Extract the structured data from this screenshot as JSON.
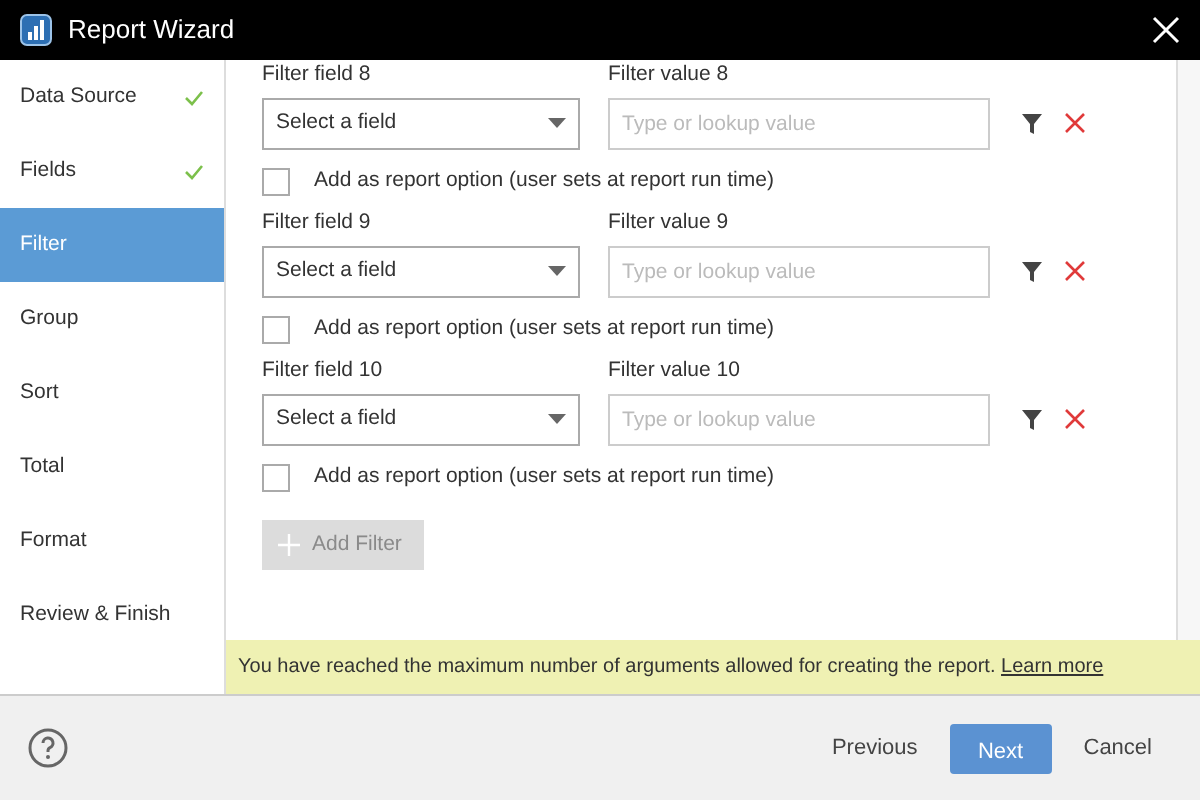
{
  "window": {
    "title": "Report Wizard"
  },
  "sidebar": {
    "items": [
      {
        "label": "Data Source",
        "done": true,
        "selected": false
      },
      {
        "label": "Fields",
        "done": true,
        "selected": false
      },
      {
        "label": "Filter",
        "done": false,
        "selected": true
      },
      {
        "label": "Group",
        "done": false,
        "selected": false
      },
      {
        "label": "Sort",
        "done": false,
        "selected": false
      },
      {
        "label": "Total",
        "done": false,
        "selected": false
      },
      {
        "label": "Format",
        "done": false,
        "selected": false
      },
      {
        "label": "Review & Finish",
        "done": false,
        "selected": false
      }
    ]
  },
  "filters": [
    {
      "field_label": "Filter field 8",
      "field_value": "Select a field",
      "value_label": "Filter value 8",
      "value_placeholder": "Type or lookup value",
      "option_label": "Add as report option (user sets at report run time)",
      "option_checked": false
    },
    {
      "field_label": "Filter field 9",
      "field_value": "Select a field",
      "value_label": "Filter value 9",
      "value_placeholder": "Type or lookup value",
      "option_label": "Add as report option (user sets at report run time)",
      "option_checked": false
    },
    {
      "field_label": "Filter field 10",
      "field_value": "Select a field",
      "value_label": "Filter value 10",
      "value_placeholder": "Type or lookup value",
      "option_label": "Add as report option (user sets at report run time)",
      "option_checked": false
    }
  ],
  "add_filter": {
    "label": "Add Filter",
    "disabled": true
  },
  "notice": {
    "text": "You have reached the maximum number of arguments allowed for creating the report.",
    "link": "Learn more"
  },
  "footer": {
    "buttons": [
      {
        "label": "Previous",
        "kind": "link"
      },
      {
        "label": "Next",
        "kind": "primary"
      },
      {
        "label": "Cancel",
        "kind": "link"
      }
    ]
  }
}
